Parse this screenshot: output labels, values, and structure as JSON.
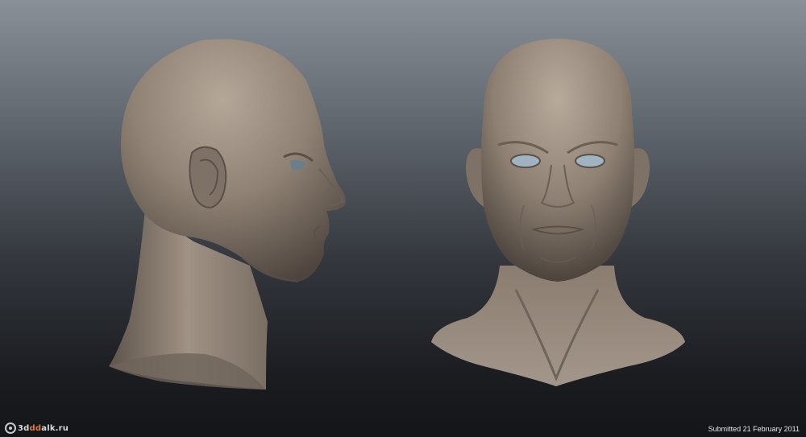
{
  "watermark": {
    "text_prefix": "3d",
    "text_accent": "dd",
    "text_suffix": "alk.ru",
    "icon": "logo-icon"
  },
  "caption": "Submitted 21 February 2011",
  "colors": {
    "skin_base": "#8c7f72",
    "skin_light": "#b3a597",
    "skin_shadow": "#5a5048",
    "eye": "#9fb3c0",
    "background_top": "#8a9098",
    "background_bottom": "#141518"
  }
}
